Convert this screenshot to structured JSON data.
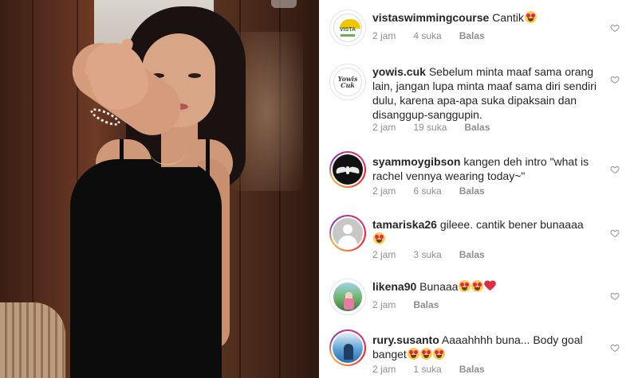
{
  "photo": {
    "alt": ""
  },
  "comments": [
    {
      "username": "vistaswimmingcourse",
      "text": "Cantik",
      "emojis": [
        "heart-eyes"
      ],
      "time": "2 jam",
      "likes": "4 suka",
      "reply": "Balas",
      "avatar": "vista-logo",
      "avatar_label": "VISTA",
      "story_ring": false
    },
    {
      "username": "yowis.cuk",
      "text": "Sebelum minta maaf sama orang lain, jangan lupa minta maaf sama diri sendiri dulu, karena apa-apa suka dipaksain dan disanggup-sanggupin.",
      "emojis": [],
      "time": "2 jam",
      "likes": "19 suka",
      "reply": "Balas",
      "avatar": "yowis-logo",
      "avatar_label": "Yowis Cuk",
      "story_ring": false
    },
    {
      "username": "syammoygibson",
      "text": "kangen deh intro \"what is rachel vennya wearing today~\"",
      "emojis": [],
      "time": "2 jam",
      "likes": "6 suka",
      "reply": "Balas",
      "avatar": "bird-photo",
      "story_ring": true
    },
    {
      "username": "tamariska26",
      "text": "gileee. cantik bener bunaaaa",
      "emojis": [
        "heart-eyes"
      ],
      "time": "2 jam",
      "likes": "3 suka",
      "reply": "Balas",
      "avatar": "default-avatar",
      "story_ring": true
    },
    {
      "username": "likena90",
      "text": "Bunaaa",
      "emojis": [
        "heart-eyes",
        "heart-eyes",
        "red-heart"
      ],
      "time": "2 jam",
      "likes": "",
      "reply": "Balas",
      "avatar": "person-photo",
      "story_ring": false
    },
    {
      "username": "rury.susanto",
      "text": "Aaaahhhh buna... Body goal banget",
      "emojis": [
        "heart-eyes",
        "heart-eyes",
        "heart-eyes"
      ],
      "time": "2 jam",
      "likes": "1 suka",
      "reply": "Balas",
      "avatar": "beach-photo",
      "story_ring": true
    }
  ],
  "icons": {
    "like": "heart-outline-icon"
  },
  "colors": {
    "text": "#262626",
    "meta": "#8e8e8e",
    "heart_emoji": "#dd2e44"
  }
}
